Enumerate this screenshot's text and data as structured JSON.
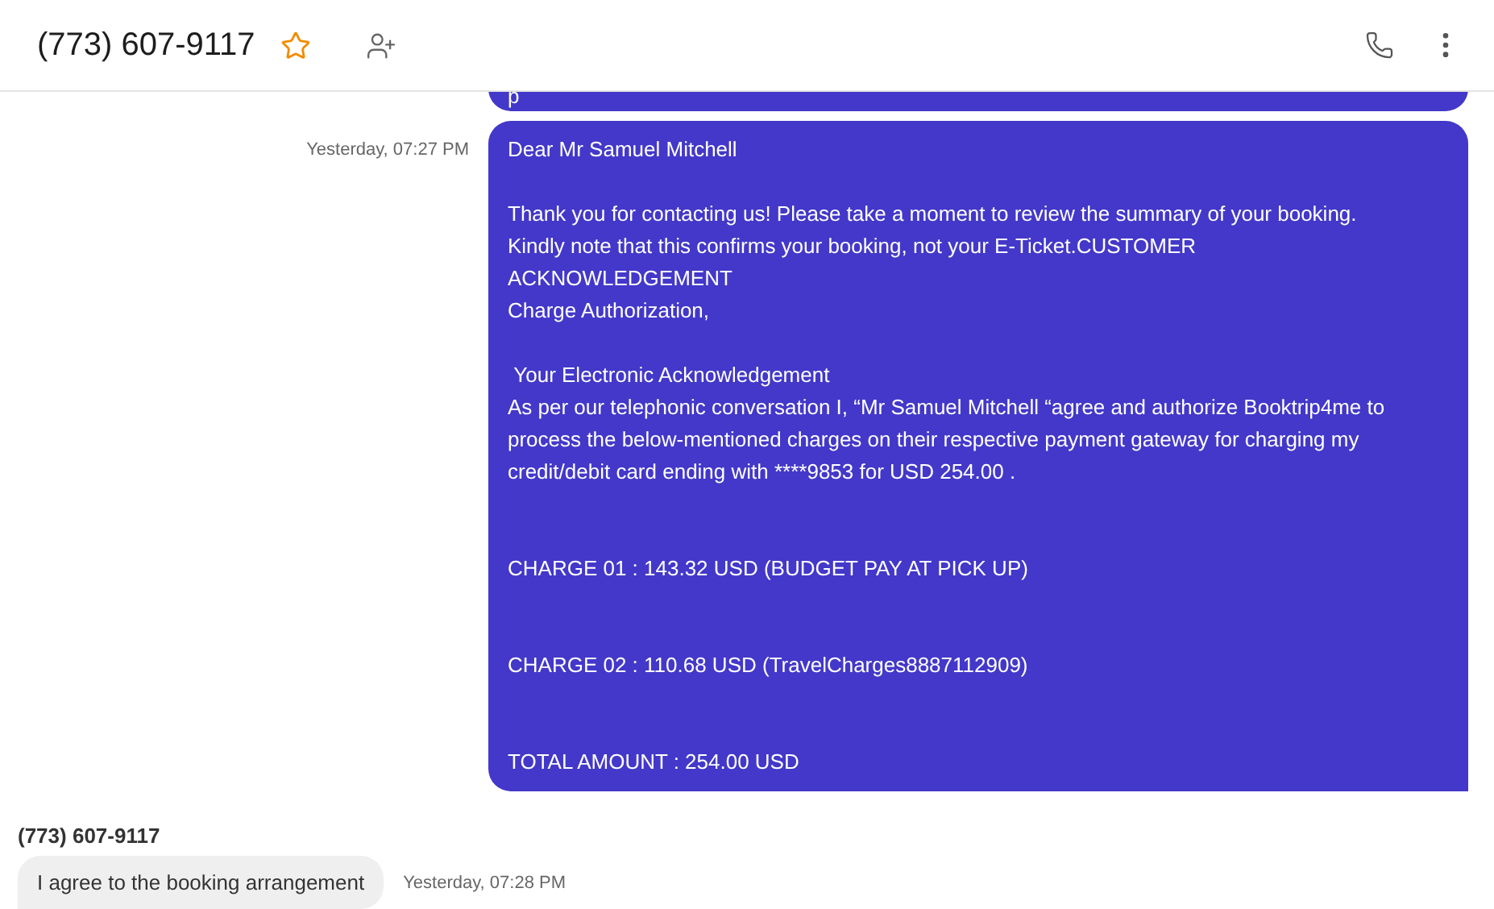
{
  "header": {
    "title": "(773) 607-9117"
  },
  "messages": [
    {
      "kind": "outgoing",
      "cut": true,
      "text": "p"
    },
    {
      "kind": "outgoing",
      "cut": false,
      "time": "Yesterday, 07:27 PM",
      "text": "Dear Mr Samuel Mitchell\n\nThank you for contacting us! Please take a moment to review the summary of your booking.\nKindly note that this confirms your booking, not your E-Ticket.CUSTOMER\nACKNOWLEDGEMENT\nCharge Authorization,\n\n Your Electronic Acknowledgement\nAs per our telephonic conversation I, “Mr Samuel Mitchell “agree and authorize Booktrip4me to process the below-mentioned charges on their respective payment gateway for charging my credit/debit card ending with ****9853 for USD 254.00 .\n\n\nCHARGE 01 : 143.32 USD (BUDGET PAY AT PICK UP)\n\n\nCHARGE 02 : 110.68 USD (TravelCharges8887112909)\n\n\nTOTAL AMOUNT : 254.00 USD"
    },
    {
      "kind": "incoming",
      "sender": "(773) 607-9117",
      "time": "Yesterday, 07:28 PM",
      "text": "I agree to the booking arrangement"
    }
  ]
}
